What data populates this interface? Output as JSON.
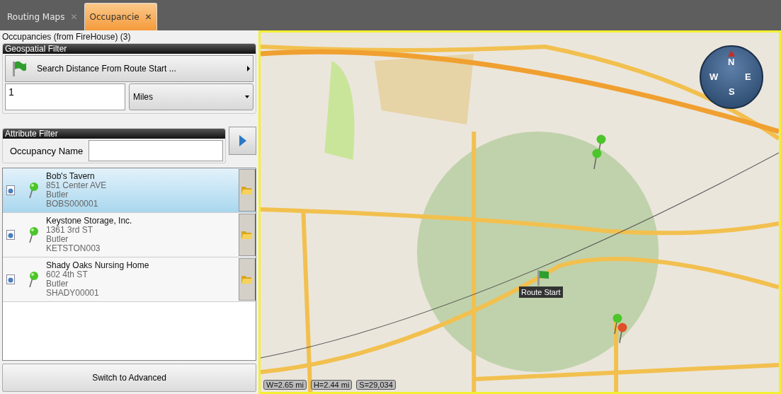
{
  "tabs": [
    {
      "label": "Routing Maps",
      "close": "✕",
      "selected": false
    },
    {
      "label": "Occupancie",
      "close": "✕",
      "selected": true
    }
  ],
  "panel_title": "Occupancies (from FireHouse) (3)",
  "geospatial_filter": {
    "title": "Geospatial Filter",
    "search_button": "Search  Distance From Route Start ...",
    "distance": "1",
    "unit": "Miles"
  },
  "attribute_filter": {
    "title": "Attribute Filter",
    "name_label": "Occupancy Name"
  },
  "occupancies": [
    {
      "name": "Bob's Tavern",
      "address": "851 Center AVE",
      "city": "Butler",
      "code": "BOBS000001",
      "selected": true
    },
    {
      "name": "Keystone Storage, Inc.",
      "address": "1361 3rd ST",
      "city": "Butler",
      "code": "KETSTON003",
      "selected": false
    },
    {
      "name": "Shady Oaks Nursing Home",
      "address": "602 4th ST",
      "city": "Butler",
      "code": "SHADY00001",
      "selected": false
    }
  ],
  "switch_button": "Switch to Advanced",
  "map": {
    "route_start_label": "Route Start",
    "compass": {
      "north": "N",
      "east": "E",
      "south": "S",
      "west": "W"
    },
    "scale": [
      "W=2.65 mi",
      "H=2.44 mi",
      "S=29,034"
    ]
  }
}
